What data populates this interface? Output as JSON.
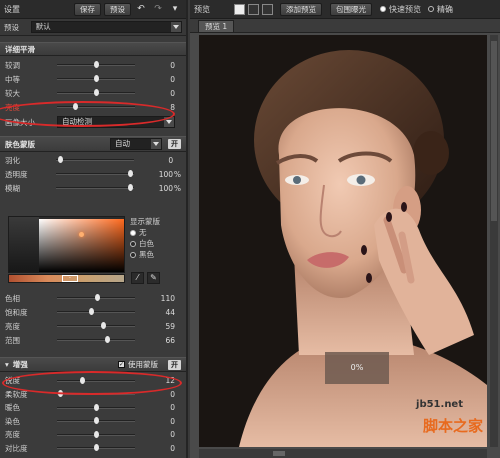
{
  "left": {
    "title": "设置",
    "save": "保存",
    "preset_btn": "预设",
    "preset_label": "预设",
    "preset_value": "默认",
    "detail": {
      "header": "详细平滑",
      "rows": [
        {
          "label": "较调",
          "value": "0",
          "pos": 0.5
        },
        {
          "label": "中等",
          "value": "0",
          "pos": 0.5
        },
        {
          "label": "较大",
          "value": "0",
          "pos": 0.5
        },
        {
          "label": "亮度",
          "value": "8",
          "pos": 0.22
        }
      ],
      "size_label": "画像大小",
      "size_value": "自动检测"
    },
    "mask": {
      "header": "肤色蒙版",
      "mode": "自动",
      "toggle": "开",
      "rows": [
        {
          "label": "羽化",
          "value": "0",
          "unit": "",
          "pos": 0.02
        },
        {
          "label": "透明度",
          "value": "100",
          "unit": "%",
          "pos": 0.98
        },
        {
          "label": "模糊",
          "value": "100",
          "unit": "%",
          "pos": 0.98
        }
      ],
      "show_label": "显示蒙版",
      "options": [
        "无",
        "白色",
        "黑色"
      ],
      "color_rows": [
        {
          "label": "色相",
          "value": "110",
          "pos": 0.52
        },
        {
          "label": "饱和度",
          "value": "44",
          "pos": 0.44
        },
        {
          "label": "亮度",
          "value": "59",
          "pos": 0.6
        },
        {
          "label": "范围",
          "value": "66",
          "pos": 0.66
        }
      ]
    },
    "enhance": {
      "header": "增强",
      "use_mask": "使用蒙版",
      "toggle": "开",
      "rows": [
        {
          "label": "锐度",
          "value": "12",
          "pos": 0.31
        },
        {
          "label": "柔软度",
          "value": "0",
          "pos": 0.02
        },
        {
          "label": "暖色",
          "value": "0",
          "pos": 0.5
        },
        {
          "label": "染色",
          "value": "0",
          "pos": 0.5
        },
        {
          "label": "亮度",
          "value": "0",
          "pos": 0.5
        },
        {
          "label": "对比度",
          "value": "0",
          "pos": 0.5
        }
      ]
    }
  },
  "right": {
    "title": "预览",
    "add_preview": "添加预览",
    "exposure": "包围曝光",
    "quick": "快速预览",
    "precise": "精确",
    "tab": "预览 1",
    "progress": "0%"
  },
  "watermark": {
    "site": "jb51.net",
    "text": "脚本之家"
  },
  "colors": {
    "accent": "#d92a2a",
    "watermark": "#e86a1e"
  }
}
